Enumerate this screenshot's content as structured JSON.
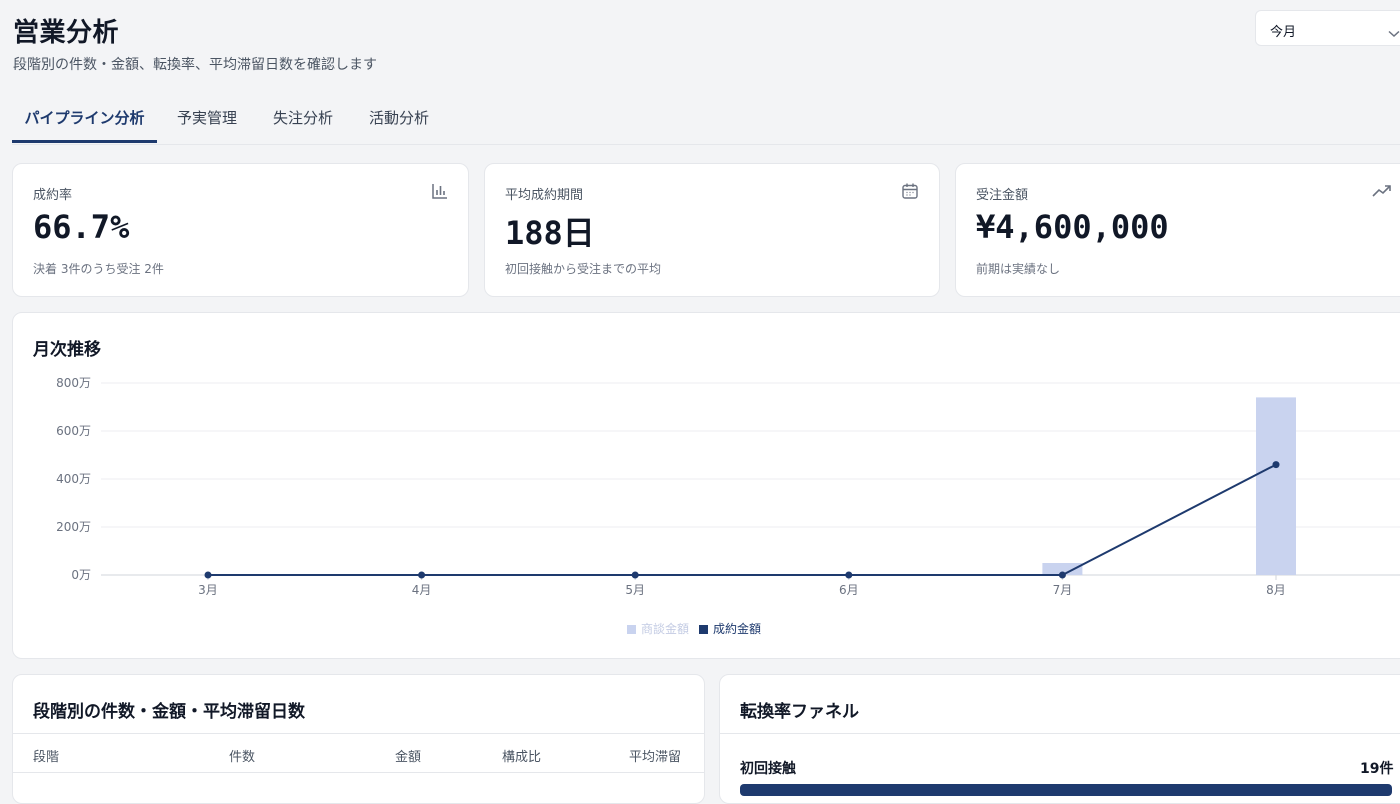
{
  "header": {
    "title": "営業分析",
    "subtitle": "段階別の件数・金額、転換率、平均滞留日数を確認します",
    "period_select": {
      "value": "今月"
    }
  },
  "tabs": [
    {
      "label": "パイプライン分析",
      "active": true
    },
    {
      "label": "予実管理",
      "active": false
    },
    {
      "label": "失注分析",
      "active": false
    },
    {
      "label": "活動分析",
      "active": false
    }
  ],
  "kpis": [
    {
      "label": "成約率",
      "value": "66.7%",
      "note": "決着 3件のうち受注 2件",
      "icon": "bar-chart-icon"
    },
    {
      "label": "平均成約期間",
      "value": "188日",
      "note": "初回接触から受注までの平均",
      "icon": "calendar-icon"
    },
    {
      "label": "受注金額",
      "value": "¥4,600,000",
      "note": "前期は実績なし",
      "icon": "trending-up-icon"
    }
  ],
  "monthly_chart": {
    "title": "月次推移",
    "colors": {
      "bar": "#c9d3ef",
      "line": "#1e3a6e",
      "grid": "#eceef2"
    }
  },
  "chart_data": {
    "type": "bar",
    "categories": [
      "3月",
      "4月",
      "5月",
      "6月",
      "7月",
      "8月"
    ],
    "y_tick_labels": [
      "800万",
      "600万",
      "400万",
      "200万",
      "0万"
    ],
    "ylim": [
      0,
      800
    ],
    "grid": true,
    "legend_position": "bottom",
    "series": [
      {
        "name": "商談金額",
        "type": "bar",
        "values": [
          0,
          0,
          0,
          0,
          50,
          740
        ]
      },
      {
        "name": "成約金額",
        "type": "line",
        "values": [
          0,
          0,
          0,
          0,
          0,
          460
        ]
      }
    ]
  },
  "stage_table": {
    "title": "段階別の件数・金額・平均滞留日数",
    "columns": [
      "段階",
      "件数",
      "金額",
      "構成比",
      "平均滞留"
    ]
  },
  "funnel": {
    "title": "転換率ファネル",
    "stages": [
      {
        "label": "初回接触",
        "count": "19件"
      }
    ]
  }
}
